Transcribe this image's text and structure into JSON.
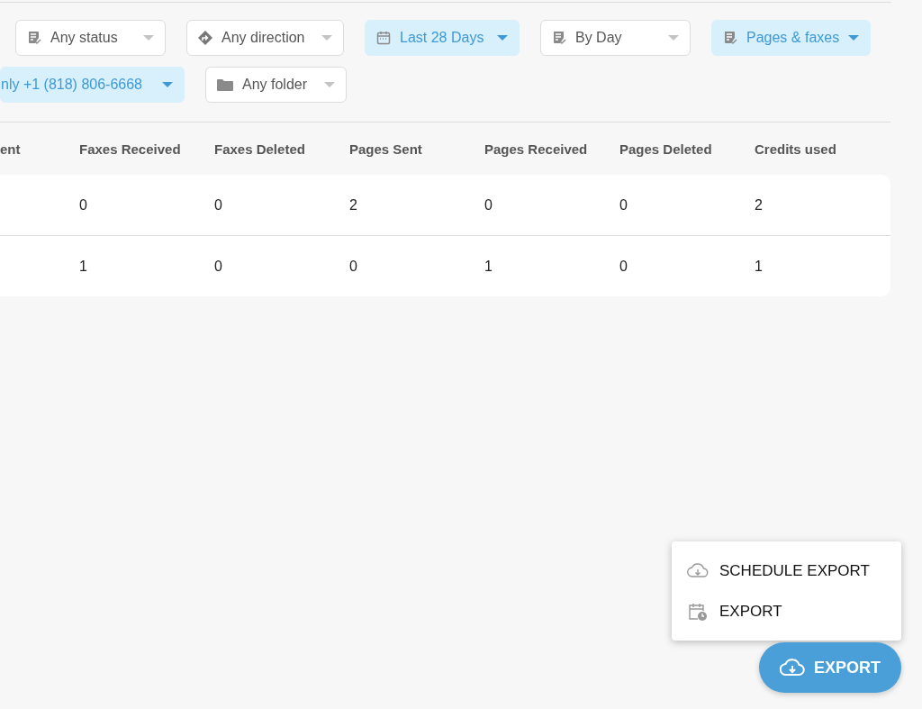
{
  "filters": [
    {
      "label": "Any status",
      "kind": "list",
      "active": false
    },
    {
      "label": "Any direction",
      "kind": "direction",
      "active": false
    },
    {
      "label": "Last 28 Days",
      "kind": "calendar",
      "active": true
    },
    {
      "label": "By Day",
      "kind": "list",
      "active": false
    },
    {
      "label": "Pages & faxes",
      "kind": "list",
      "active": true
    },
    {
      "label": "nly +1 (818) 806-6668",
      "kind": "plain",
      "active": true
    },
    {
      "label": "Any folder",
      "kind": "folder",
      "active": false
    }
  ],
  "table": {
    "columns": [
      "ent",
      "Faxes Received",
      "Faxes Deleted",
      "Pages Sent",
      "Pages Received",
      "Pages Deleted",
      "Credits used"
    ],
    "rows": [
      {
        "cells": [
          "",
          "0",
          "0",
          "2",
          "0",
          "0",
          "2"
        ]
      },
      {
        "cells": [
          "",
          "1",
          "0",
          "0",
          "1",
          "0",
          "1"
        ]
      }
    ]
  },
  "export_menu": {
    "items": [
      {
        "label": "SCHEDULE EXPORT",
        "kind": "cloud"
      },
      {
        "label": "EXPORT",
        "kind": "calendar-clock"
      }
    ]
  },
  "export_button": {
    "label": "EXPORT"
  }
}
